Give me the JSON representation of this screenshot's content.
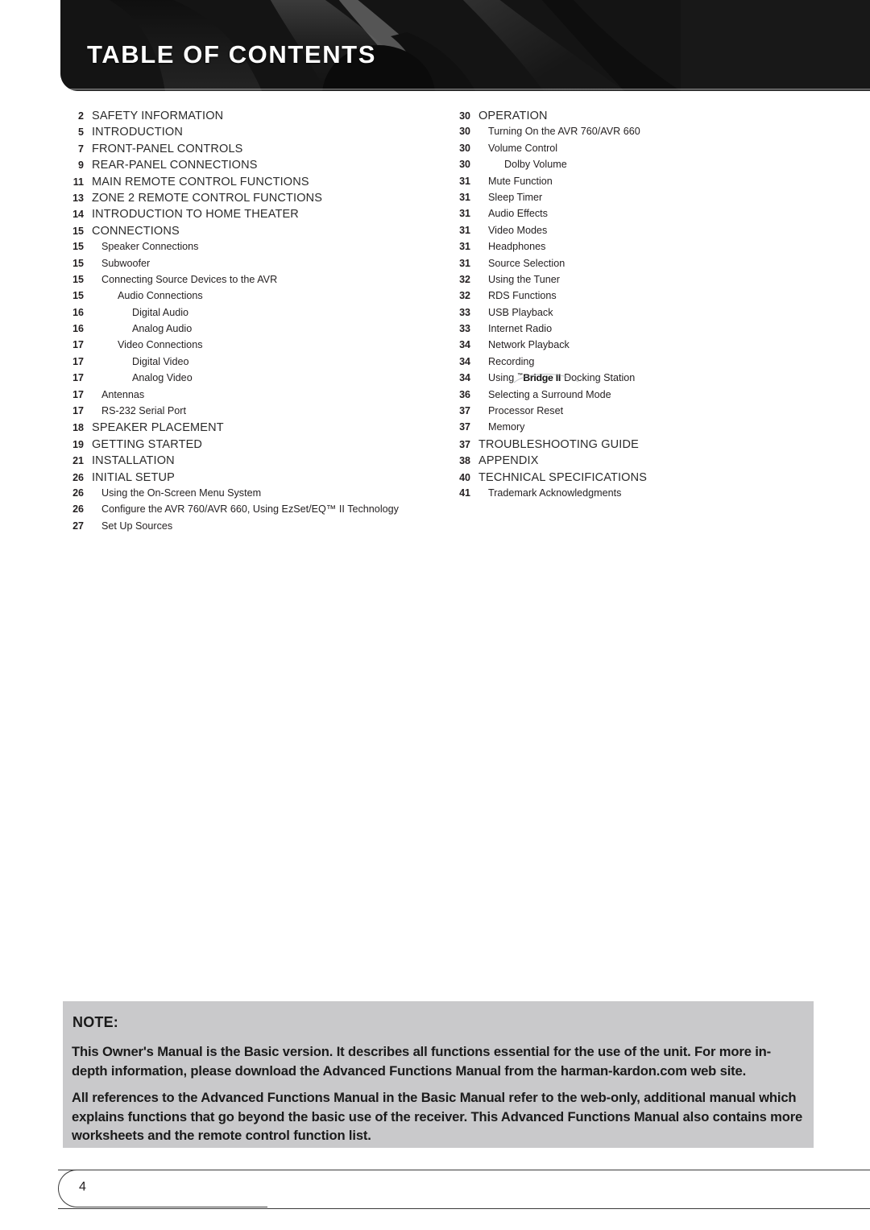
{
  "header": {
    "title": "TABLE OF CONTENTS"
  },
  "toc": {
    "left_column": [
      {
        "page": "2",
        "label": "SAFETY INFORMATION",
        "level": 0
      },
      {
        "page": "5",
        "label": "INTRODUCTION",
        "level": 0
      },
      {
        "page": "7",
        "label": "FRONT-PANEL CONTROLS",
        "level": 0
      },
      {
        "page": "9",
        "label": "REAR-PANEL CONNECTIONS",
        "level": 0
      },
      {
        "page": "11",
        "label": "MAIN REMOTE CONTROL FUNCTIONS",
        "level": 0
      },
      {
        "page": "13",
        "label": "ZONE 2 REMOTE CONTROL FUNCTIONS",
        "level": 0
      },
      {
        "page": "14",
        "label": "INTRODUCTION TO HOME THEATER",
        "level": 0
      },
      {
        "page": "15",
        "label": "CONNECTIONS",
        "level": 0
      },
      {
        "page": "15",
        "label": "Speaker Connections",
        "level": 1
      },
      {
        "page": "15",
        "label": "Subwoofer",
        "level": 1
      },
      {
        "page": "15",
        "label": "Connecting Source Devices to the AVR",
        "level": 1
      },
      {
        "page": "15",
        "label": "Audio Connections",
        "level": 2
      },
      {
        "page": "16",
        "label": "Digital Audio",
        "level": 3
      },
      {
        "page": "16",
        "label": "Analog Audio",
        "level": 3
      },
      {
        "page": "17",
        "label": "Video Connections",
        "level": 2
      },
      {
        "page": "17",
        "label": "Digital Video",
        "level": 3
      },
      {
        "page": "17",
        "label": "Analog Video",
        "level": 3
      },
      {
        "page": "17",
        "label": "Antennas",
        "level": 1
      },
      {
        "page": "17",
        "label": "RS-232 Serial Port",
        "level": 1
      },
      {
        "page": "18",
        "label": "SPEAKER PLACEMENT",
        "level": 0
      },
      {
        "page": "19",
        "label": "GETTING STARTED",
        "level": 0
      },
      {
        "page": "21",
        "label": "INSTALLATION",
        "level": 0
      },
      {
        "page": "26",
        "label": "INITIAL SETUP",
        "level": 0
      },
      {
        "page": "26",
        "label": "Using the On-Screen Menu System",
        "level": 1
      },
      {
        "page": "26",
        "label": "Configure the AVR 760/AVR 660, Using EzSet/EQ™ II Technology",
        "level": 1
      },
      {
        "page": "27",
        "label": "Set Up Sources",
        "level": 1
      }
    ],
    "right_column": [
      {
        "page": "30",
        "label": "OPERATION",
        "level": 0
      },
      {
        "page": "30",
        "label": "Turning On the AVR 760/AVR 660",
        "level": 1
      },
      {
        "page": "30",
        "label": "Volume Control",
        "level": 1
      },
      {
        "page": "30",
        "label": "Dolby Volume",
        "level": 2
      },
      {
        "page": "31",
        "label": "Mute Function",
        "level": 1
      },
      {
        "page": "31",
        "label": "Sleep Timer",
        "level": 1
      },
      {
        "page": "31",
        "label": "Audio Effects",
        "level": 1
      },
      {
        "page": "31",
        "label": "Video Modes",
        "level": 1
      },
      {
        "page": "31",
        "label": "Headphones",
        "level": 1
      },
      {
        "page": "31",
        "label": "Source Selection",
        "level": 1
      },
      {
        "page": "32",
        "label": "Using the Tuner",
        "level": 1
      },
      {
        "page": "32",
        "label": "RDS Functions",
        "level": 1
      },
      {
        "page": "33",
        "label": "USB Playback",
        "level": 1
      },
      {
        "page": "33",
        "label": "Internet Radio",
        "level": 1
      },
      {
        "page": "34",
        "label": "Network Playback",
        "level": 1
      },
      {
        "page": "34",
        "label": "Recording",
        "level": 1
      },
      {
        "page": "34",
        "label": "Using The Bridge II Docking Station",
        "level": 1,
        "logo": true,
        "prefix": "Using",
        "logo_tm": "™",
        "logo_text": "Bridge II",
        "suffix": "Docking Station"
      },
      {
        "page": "36",
        "label": "Selecting a Surround Mode",
        "level": 1
      },
      {
        "page": "37",
        "label": "Processor Reset",
        "level": 1
      },
      {
        "page": "37",
        "label": "Memory",
        "level": 1
      },
      {
        "page": "37",
        "label": "TROUBLESHOOTING GUIDE",
        "level": 0
      },
      {
        "page": "38",
        "label": "APPENDIX",
        "level": 0
      },
      {
        "page": "40",
        "label": "TECHNICAL SPECIFICATIONS",
        "level": 0
      },
      {
        "page": "41",
        "label": "Trademark Acknowledgments",
        "level": 1
      }
    ]
  },
  "note": {
    "title": "NOTE:",
    "paragraph1": "This Owner's Manual is the Basic version. It describes all functions essential for the use of the unit. For more in-depth information, please download the Advanced Functions Manual from the harman-kardon.com web site.",
    "paragraph2": "All references to the Advanced Functions Manual in the Basic Manual refer to the web-only, additional manual which explains functions that go beyond the basic use of the receiver. This Advanced Functions Manual also contains more worksheets and the remote control function list."
  },
  "footer": {
    "page_number": "4"
  },
  "colors": {
    "banner": "#131313",
    "note_background": "#c9c9cb",
    "text": "#231f20"
  }
}
